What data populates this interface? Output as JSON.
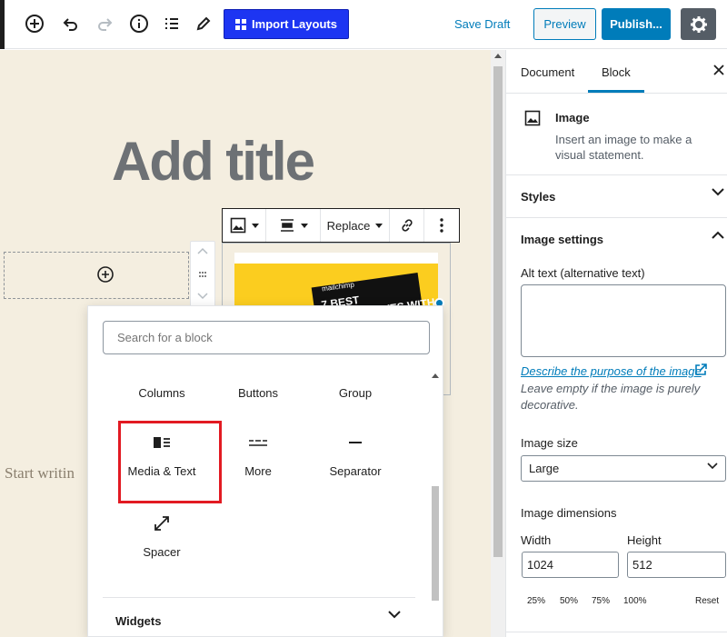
{
  "toolbar": {
    "import_label": "Import Layouts",
    "save_draft": "Save Draft",
    "preview": "Preview",
    "publish": "Publish..."
  },
  "canvas": {
    "title_placeholder": "Add title",
    "body_placeholder": "Start writin",
    "block_toolbar": {
      "replace_label": "Replace"
    },
    "image_text": {
      "brand": "mailchimp",
      "headline_1": "7 BEST",
      "headline_2": "ALTERNATIVES WITH"
    }
  },
  "inserter": {
    "search_placeholder": "Search for a block",
    "categories": [
      "Columns",
      "Buttons",
      "Group"
    ],
    "blocks": [
      {
        "label": "Media & Text",
        "icon": "media-text-icon"
      },
      {
        "label": "More",
        "icon": "more-icon"
      },
      {
        "label": "Separator",
        "icon": "separator-icon"
      },
      {
        "label": "Spacer",
        "icon": "spacer-icon"
      }
    ],
    "widgets_label": "Widgets"
  },
  "sidebar": {
    "tabs": [
      "Document",
      "Block"
    ],
    "active_tab": "Block",
    "block_name": "Image",
    "block_description": "Insert an image to make a visual statement.",
    "styles_label": "Styles",
    "image_settings_label": "Image settings",
    "alt_label": "Alt text (alternative text)",
    "alt_value": "",
    "describe_link": "Describe the purpose of the image",
    "help_text": "Leave empty if the image is purely decorative.",
    "image_size_label": "Image size",
    "image_size_value": "Large",
    "dimensions_label": "Image dimensions",
    "width_label": "Width",
    "height_label": "Height",
    "width_value": "1024",
    "height_value": "512",
    "percent_buttons": [
      "25%",
      "50%",
      "75%",
      "100%"
    ],
    "reset_label": "Reset"
  },
  "colors": {
    "accent": "#007cba",
    "import_button": "#1d35f2",
    "canvas_bg": "#f4eee0",
    "highlight": "#e21a22"
  }
}
